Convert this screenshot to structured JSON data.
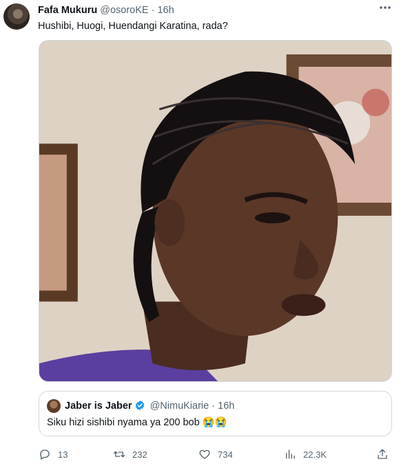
{
  "tweet": {
    "author_name": "Fafa Mukuru",
    "handle": "@osoroKE",
    "separator": "·",
    "time": "16h",
    "more_icon": "more-horizontal-icon",
    "text": "Hushibi, Huogi, Huendangi Karatina, rada?",
    "media_icon": "photo"
  },
  "quote": {
    "author_name": "Jaber is Jaber",
    "verified_icon": "verified-badge-icon",
    "handle": "@NimuKiarie",
    "separator": "·",
    "time": "16h",
    "text": "Siku hizi sishibi nyama ya 200 bob 😭😭"
  },
  "actions": {
    "reply_count": "13",
    "retweet_count": "232",
    "like_count": "734",
    "views_count": "22.3K"
  },
  "colors": {
    "text_primary": "#0f1419",
    "text_secondary": "#536471",
    "border": "#cfd9de",
    "verified": "#1d9bf0"
  }
}
